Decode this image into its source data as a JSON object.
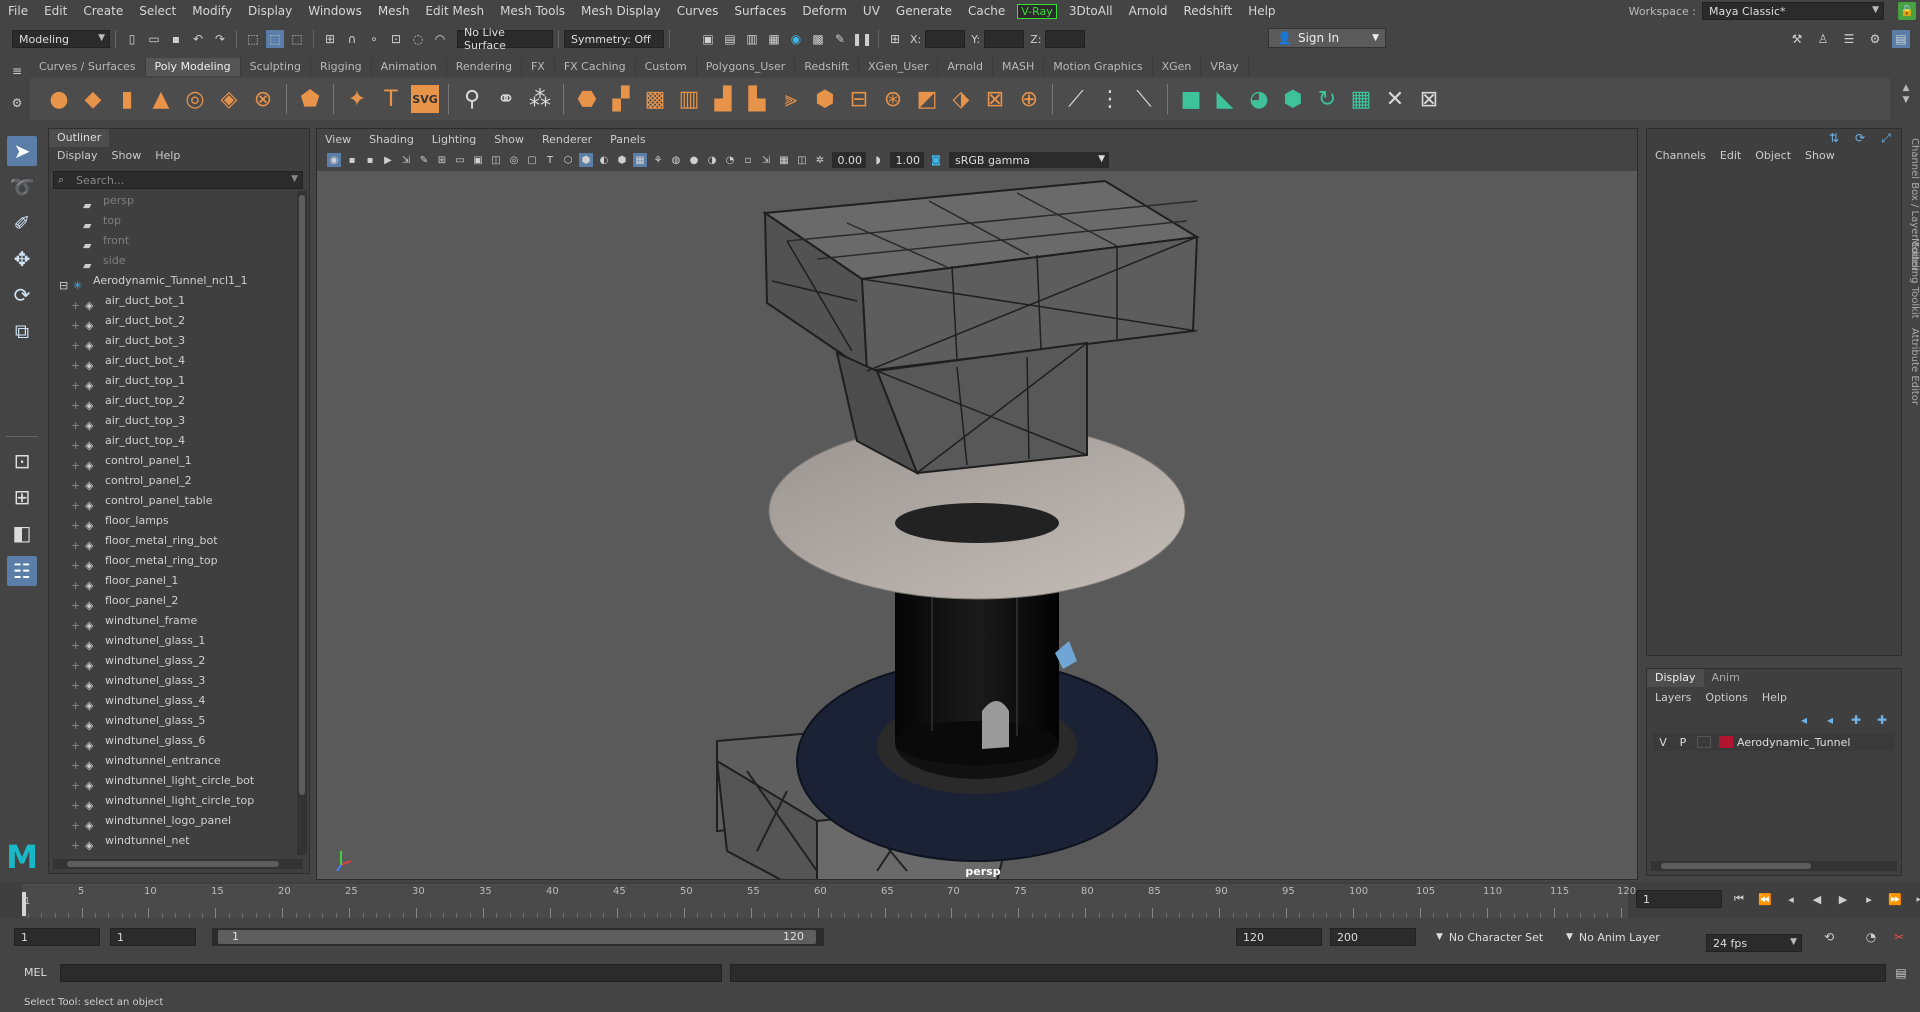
{
  "menu": [
    "File",
    "Edit",
    "Create",
    "Select",
    "Modify",
    "Display",
    "Windows",
    "Mesh",
    "Edit Mesh",
    "Mesh Tools",
    "Mesh Display",
    "Curves",
    "Surfaces",
    "Deform",
    "UV",
    "Generate",
    "Cache",
    "V-Ray",
    "3DtoAll",
    "Arnold",
    "Redshift",
    "Help"
  ],
  "workspace": {
    "label": "Workspace :",
    "value": "Maya Classic*"
  },
  "status": {
    "mode": "Modeling",
    "live_surface": "No Live Surface",
    "symmetry": "Symmetry: Off",
    "x_label": "X:",
    "y_label": "Y:",
    "z_label": "Z:",
    "sign_in": "Sign In"
  },
  "shelf_tabs": [
    "Curves / Surfaces",
    "Poly Modeling",
    "Sculpting",
    "Rigging",
    "Animation",
    "Rendering",
    "FX",
    "FX Caching",
    "Custom",
    "Polygons_User",
    "Redshift",
    "XGen_User",
    "Arnold",
    "MASH",
    "Motion Graphics",
    "XGen",
    "VRay"
  ],
  "shelf_active_tab": "Poly Modeling",
  "outliner": {
    "title": "Outliner",
    "menu": [
      "Display",
      "Show",
      "Help"
    ],
    "search_placeholder": "Search...",
    "cameras": [
      "persp",
      "top",
      "front",
      "side"
    ],
    "group": "Aerodynamic_Tunnel_ncl1_1",
    "items": [
      "air_duct_bot_1",
      "air_duct_bot_2",
      "air_duct_bot_3",
      "air_duct_bot_4",
      "air_duct_top_1",
      "air_duct_top_2",
      "air_duct_top_3",
      "air_duct_top_4",
      "control_panel_1",
      "control_panel_2",
      "control_panel_table",
      "floor_lamps",
      "floor_metal_ring_bot",
      "floor_metal_ring_top",
      "floor_panel_1",
      "floor_panel_2",
      "windtunel_frame",
      "windtunel_glass_1",
      "windtunel_glass_2",
      "windtunel_glass_3",
      "windtunel_glass_4",
      "windtunel_glass_5",
      "windtunel_glass_6",
      "windtunnel_entrance",
      "windtunnel_light_circle_bot",
      "windtunnel_light_circle_top",
      "windtunnel_logo_panel",
      "windtunnel_net"
    ]
  },
  "viewport": {
    "menu": [
      "View",
      "Shading",
      "Lighting",
      "Show",
      "Renderer",
      "Panels"
    ],
    "exposure": "0.00",
    "gamma": "1.00",
    "color_space": "sRGB gamma",
    "camera_label": "persp"
  },
  "channel_box": {
    "menu": [
      "Channels",
      "Edit",
      "Object",
      "Show"
    ]
  },
  "layer_editor": {
    "tabs": [
      "Display",
      "Anim"
    ],
    "menu": [
      "Layers",
      "Options",
      "Help"
    ],
    "layer": {
      "v": "V",
      "p": "P",
      "name": "Aerodynamic_Tunnel",
      "color": "#b0142e"
    }
  },
  "side_tabs": [
    "Channel Box / Layer Editor",
    "Modeling Toolkit",
    "Attribute Editor"
  ],
  "timeline": {
    "ticks": [
      "5",
      "10",
      "15",
      "20",
      "25",
      "30",
      "35",
      "40",
      "45",
      "50",
      "55",
      "60",
      "65",
      "70",
      "75",
      "80",
      "85",
      "90",
      "95",
      "100",
      "105",
      "110",
      "115",
      "120"
    ],
    "first_tick": "1",
    "current_frame": "1"
  },
  "range": {
    "start": "1",
    "playback_start": "1",
    "range_start": "1",
    "range_end": "120",
    "playback_end": "120",
    "end": "200",
    "character_set": "No Character Set",
    "anim_layer": "No Anim Layer",
    "fps": "24 fps"
  },
  "command": {
    "label": "MEL"
  },
  "help_line": "Select Tool: select an object",
  "colors": {
    "accent_orange": "#e8934a",
    "accent_teal": "#3ec29a",
    "vray_green": "#36e036",
    "maya_logo": "#18b8c8"
  }
}
